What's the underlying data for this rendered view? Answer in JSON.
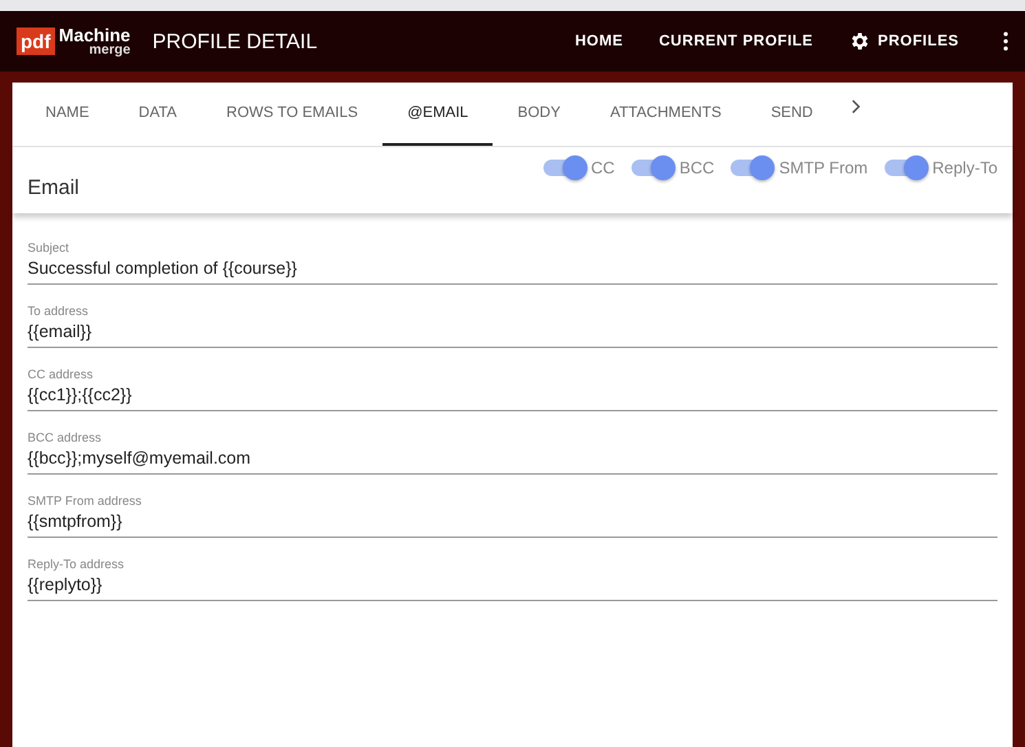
{
  "app_bar": {
    "logo": {
      "badge": "pdf",
      "name": "Machine",
      "sub": "merge"
    },
    "title": "PROFILE DETAIL",
    "nav": [
      {
        "label": "HOME",
        "kind": "text"
      },
      {
        "label": "CURRENT PROFILE",
        "kind": "text"
      },
      {
        "label": "PROFILES",
        "kind": "gear"
      }
    ]
  },
  "tabs": [
    {
      "label": "NAME",
      "selected": false
    },
    {
      "label": "DATA",
      "selected": false
    },
    {
      "label": "ROWS TO EMAILS",
      "selected": false
    },
    {
      "label": "@EMAIL",
      "selected": true
    },
    {
      "label": "BODY",
      "selected": false
    },
    {
      "label": "ATTACHMENTS",
      "selected": false
    },
    {
      "label": "SEND",
      "selected": false
    }
  ],
  "section": {
    "title": "Email",
    "toggles": [
      {
        "label": "CC",
        "on": true
      },
      {
        "label": "BCC",
        "on": true
      },
      {
        "label": "SMTP From",
        "on": true
      },
      {
        "label": "Reply-To",
        "on": true
      }
    ]
  },
  "fields": [
    {
      "label": "Subject",
      "value": "Successful completion of {{course}}"
    },
    {
      "label": "To address",
      "value": "{{email}}"
    },
    {
      "label": "CC address",
      "value": "{{cc1}};{{cc2}}"
    },
    {
      "label": "BCC address",
      "value": "{{bcc}};myself@myemail.com"
    },
    {
      "label": "SMTP From address",
      "value": "{{smtpfrom}}"
    },
    {
      "label": "Reply-To address",
      "value": "{{replyto}}"
    }
  ]
}
